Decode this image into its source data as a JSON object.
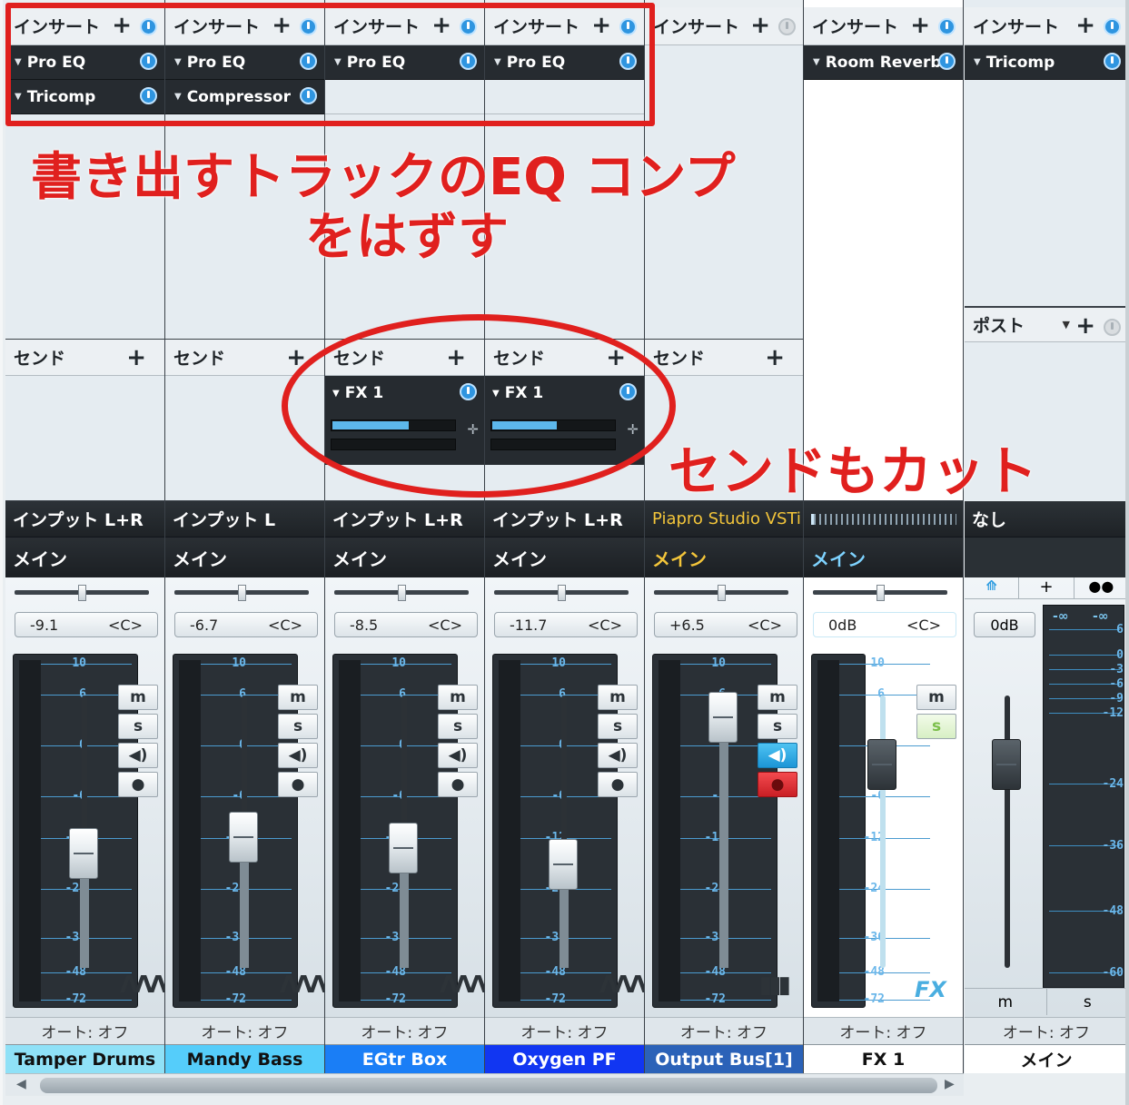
{
  "strips": [
    {
      "name": "Tamper Drums",
      "name_bg": "#8fe1f7",
      "name_fg": "#111111",
      "inserts_header": "インサート",
      "inserts": [
        "Pro EQ",
        "Tricomp"
      ],
      "send_header": "センド",
      "sends": [],
      "input": "インプット L+R",
      "output": "メイン",
      "volume": "-9.1",
      "pan": "<C>",
      "pan_pos": 0.5,
      "fader_pos": 0.42
    },
    {
      "name": "Mandy Bass",
      "name_bg": "#55cdfa",
      "name_fg": "#111111",
      "inserts_header": "インサート",
      "inserts": [
        "Pro EQ",
        "Compressor"
      ],
      "send_header": "センド",
      "sends": [],
      "input": "インプット L",
      "output": "メイン",
      "volume": "-6.7",
      "pan": "<C>",
      "pan_pos": 0.5,
      "fader_pos": 0.48
    },
    {
      "name": "EGtr Box",
      "name_bg": "#1a7ef6",
      "name_fg": "#ffffff",
      "inserts_header": "インサート",
      "inserts": [
        "Pro EQ"
      ],
      "send_header": "センド",
      "sends": [
        {
          "label": "FX 1",
          "level": 0.62
        }
      ],
      "input": "インプット L+R",
      "output": "メイン",
      "volume": "-8.5",
      "pan": "<C>",
      "pan_pos": 0.5,
      "fader_pos": 0.44
    },
    {
      "name": "Oxygen PF",
      "name_bg": "#1136f2",
      "name_fg": "#ffffff",
      "inserts_header": "インサート",
      "inserts": [
        "Pro EQ"
      ],
      "send_header": "センド",
      "sends": [
        {
          "label": "FX 1",
          "level": 0.52
        }
      ],
      "input": "インプット L+R",
      "output": "メイン",
      "volume": "-11.7",
      "pan": "<C>",
      "pan_pos": 0.5,
      "fader_pos": 0.38
    },
    {
      "name": "Output Bus[1]",
      "name_bg": "#2b62b8",
      "name_fg": "#ffffff",
      "inserts_header": "インサート",
      "inserts": [],
      "send_header": "センド",
      "sends": [],
      "input": "Piapro Studio VSTi",
      "output": "メイン",
      "volume": "+6.5",
      "pan": "<C>",
      "pan_pos": 0.5,
      "fader_pos": 0.92
    }
  ],
  "fx_strip": {
    "name": "FX 1",
    "inserts_header": "インサート",
    "insert": "Room Reverb",
    "output": "メイン",
    "volume": "0dB",
    "pan": "<C>",
    "badge": "FX"
  },
  "main_strip": {
    "name": "メイン",
    "inserts_header": "インサート",
    "insert": "Tricomp",
    "post_header": "ポスト",
    "input": "なし",
    "volume": "0dB",
    "peak_left": "-∞",
    "peak_right": "-∞",
    "scale": [
      "6",
      "0",
      "-3",
      "-6",
      "-9",
      "-12",
      "-24",
      "-36",
      "-48",
      "-60"
    ]
  },
  "meter_scale": [
    "10",
    "6",
    "0",
    "-6",
    "-12",
    "-24",
    "-36",
    "-48",
    "-72"
  ],
  "buttons": {
    "mute": "m",
    "solo": "s"
  },
  "automation": "オート: オフ",
  "annotations": {
    "line1": "書き出すトラックのEQ コンプ",
    "line2": "をはずす",
    "line3": "センドもカット",
    "color": "#e0201e"
  }
}
